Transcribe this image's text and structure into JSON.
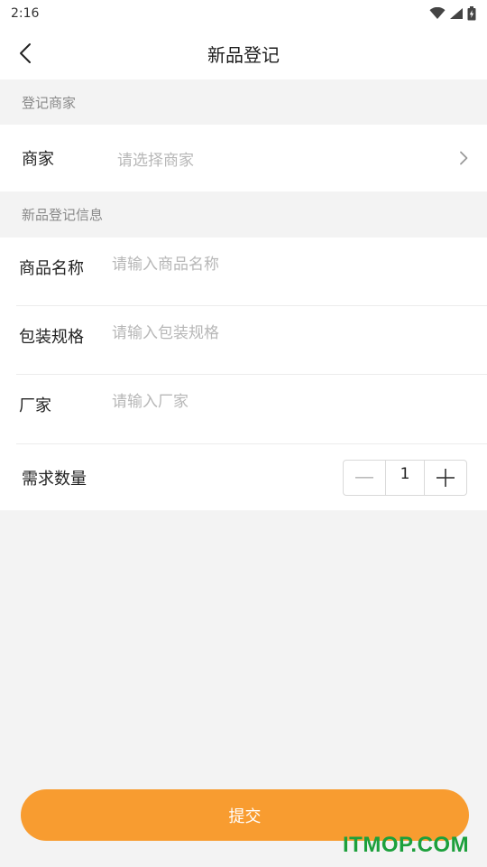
{
  "status_bar": {
    "time": "2:16",
    "icons": [
      "wifi-icon",
      "signal-icon",
      "battery-charging-icon"
    ]
  },
  "nav": {
    "title": "新品登记",
    "back_icon": "chevron-left-icon"
  },
  "merchant_section": {
    "header": "登记商家",
    "label": "商家",
    "placeholder": "请选择商家",
    "arrow_icon": "chevron-right-icon"
  },
  "info_section": {
    "header": "新品登记信息",
    "fields": [
      {
        "label": "商品名称",
        "placeholder": "请输入商品名称",
        "value": ""
      },
      {
        "label": "包装规格",
        "placeholder": "请输入包装规格",
        "value": ""
      },
      {
        "label": "厂家",
        "placeholder": "请输入厂家",
        "value": ""
      }
    ],
    "quantity": {
      "label": "需求数量",
      "value": "1",
      "minus_icon": "minus-icon",
      "plus_icon": "plus-icon"
    }
  },
  "submit_label": "提交",
  "watermark": "ITMOP.COM",
  "colors": {
    "accent": "#f89c30",
    "background": "#f3f3f3",
    "placeholder": "#b7b7b7",
    "watermark": "#1ca03c"
  }
}
